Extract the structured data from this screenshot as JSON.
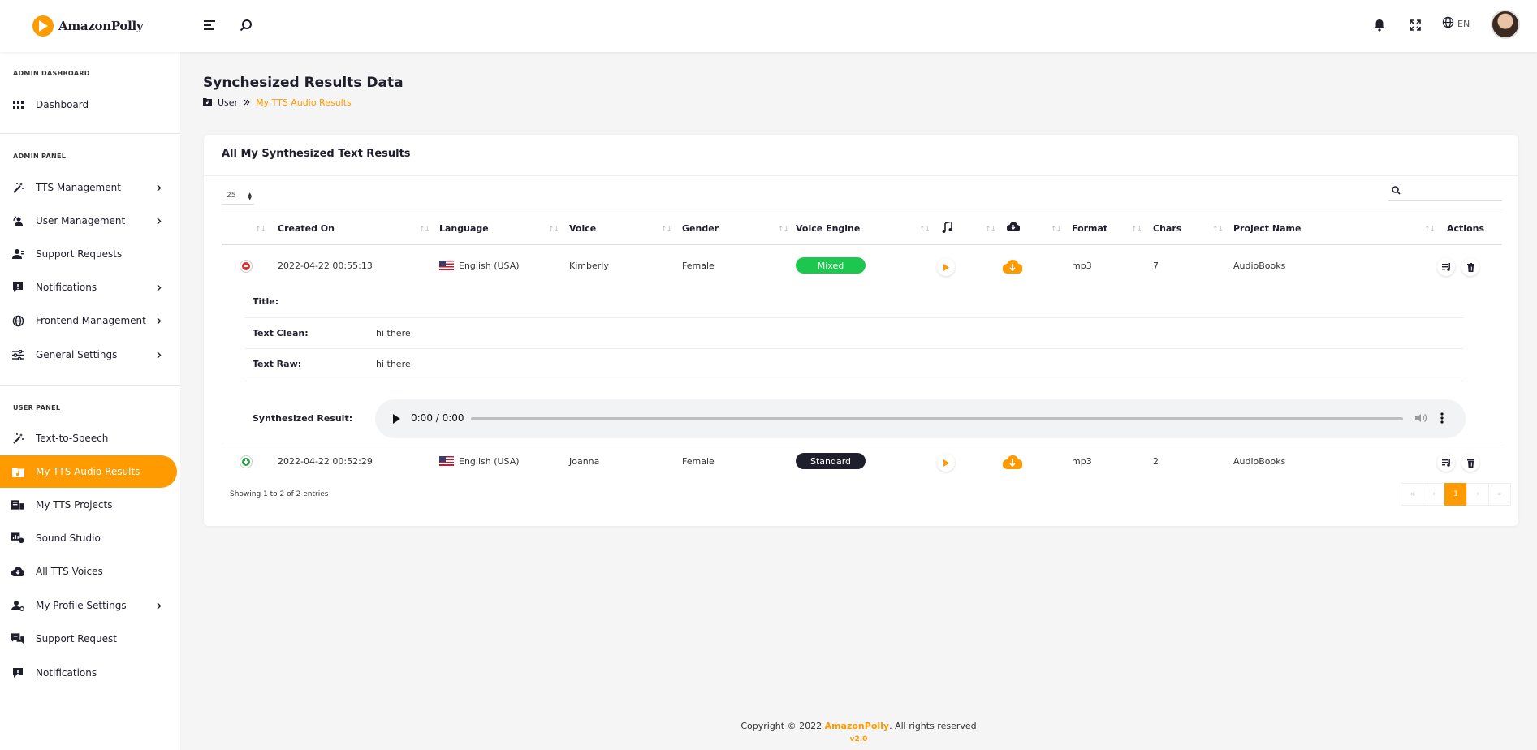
{
  "app": {
    "logo_text": "AmazonPolly",
    "accent": "#ff9a00"
  },
  "topbar": {
    "language": "EN",
    "icons": [
      "menu-icon",
      "search-icon",
      "bell-icon",
      "fullscreen-icon",
      "globe-icon"
    ]
  },
  "sidebar": {
    "admin_dashboard_title": "ADMIN DASHBOARD",
    "admin_panel_title": "ADMIN PANEL",
    "user_panel_title": "USER PANEL",
    "items": [
      {
        "label": "Dashboard",
        "icon": "grid-icon"
      },
      {
        "label": "TTS Management",
        "icon": "magic-wand-icon",
        "has_children": true
      },
      {
        "label": "User Management",
        "icon": "user-management-icon",
        "has_children": true
      },
      {
        "label": "Support Requests",
        "icon": "user-icon"
      },
      {
        "label": "Notifications",
        "icon": "alert-message-icon",
        "has_children": true
      },
      {
        "label": "Frontend Management",
        "icon": "globe-icon",
        "has_children": true
      },
      {
        "label": "General Settings",
        "icon": "sliders-icon",
        "has_children": true
      },
      {
        "label": "Text-to-Speech",
        "icon": "magic-wand-icon"
      },
      {
        "label": "My TTS Audio Results",
        "icon": "audio-folder-icon",
        "active": true
      },
      {
        "label": "My TTS Projects",
        "icon": "projects-icon"
      },
      {
        "label": "Sound Studio",
        "icon": "studio-icon"
      },
      {
        "label": "All TTS Voices",
        "icon": "cloud-voice-icon"
      },
      {
        "label": "My Profile Settings",
        "icon": "user-settings-icon",
        "has_children": true
      },
      {
        "label": "Support Request",
        "icon": "support-chat-icon"
      },
      {
        "label": "Notifications",
        "icon": "alert-message-icon"
      }
    ]
  },
  "page": {
    "title": "Synchesized Results Data",
    "breadcrumb": {
      "parent": "User",
      "current": "My TTS Audio Results"
    }
  },
  "card": {
    "title": "All My Synthesized Text Results",
    "page_length": "25",
    "columns": [
      "Created On",
      "Language",
      "Voice",
      "Gender",
      "Voice Engine",
      "Format",
      "Chars",
      "Project Name",
      "Actions"
    ],
    "rows": [
      {
        "created": "2022-04-22 00:55:13",
        "language": "English (USA)",
        "voice": "Kimberly",
        "gender": "Female",
        "engine": "Mixed",
        "engine_color": "#1dc64f",
        "format": "mp3",
        "chars": "7",
        "project": "AudioBooks",
        "expanded": true
      },
      {
        "created": "2022-04-22 00:52:29",
        "language": "English (USA)",
        "voice": "Joanna",
        "gender": "Female",
        "engine": "Standard",
        "engine_color": "#1e1e2d",
        "format": "mp3",
        "chars": "2",
        "project": "AudioBooks",
        "expanded": false
      }
    ],
    "detail": {
      "title_label": "Title:",
      "title_value": "",
      "text_clean_label": "Text Clean:",
      "text_clean_value": "hi there",
      "text_raw_label": "Text Raw:",
      "text_raw_value": "hi there",
      "synth_label": "Synthesized Result:",
      "player_time": "0:00 / 0:00"
    },
    "info": "Showing 1 to 2 of 2 entries",
    "pagination": {
      "first": "«",
      "prev": "‹",
      "current": "1",
      "next": "›",
      "last": "»"
    }
  },
  "footer": {
    "prefix": "Copyright © 2022 ",
    "brand": "AmazonPolly",
    "suffix": ". All rights reserved",
    "version": "v2.0"
  }
}
